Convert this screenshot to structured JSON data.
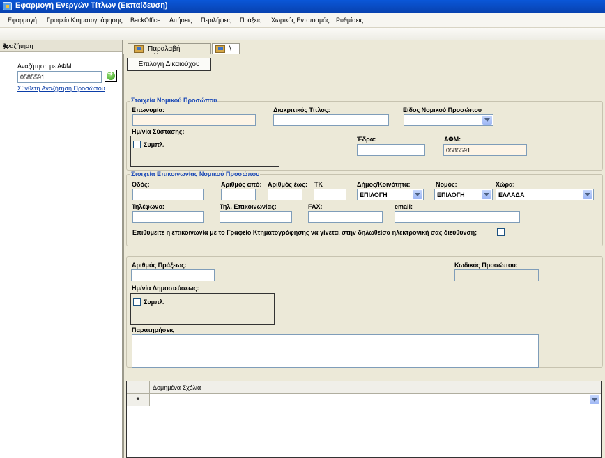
{
  "window": {
    "title": "Εφαρμογή Ενεργών Τίτλων (Εκπαίδευση)"
  },
  "menu": [
    "Εφαρμογή",
    "Γραφείο Κτηματογράφησης",
    "BackOffice",
    "Αιτήσεις",
    "Περιλήψεις",
    "Πράξεις",
    "Χωρικός Εντοπισμός",
    "Ρυθμίσεις"
  ],
  "search_panel": {
    "title": "Αναζήτηση",
    "afm_label": "Αναζήτηση με ΑΦΜ:",
    "afm_value": "0585591",
    "advanced_link": "Σύνθετη Αναζήτηση Προσώπου",
    "pin_glyph": "ᵖ",
    "close_glyph": "✕"
  },
  "tabs": [
    {
      "label": "Παραλαβή Δήλωσης"
    },
    {
      "label": "\\"
    }
  ],
  "select_beneficiary_button": "Επιλογή Δικαιούχου",
  "legal_entity": {
    "title": "Στοιχεία Νομικού Προσώπου",
    "name_label": "Επωνυμία:",
    "name_value": "",
    "distinctive_title_label": "Διακριτικός Τίτλος:",
    "distinctive_title_value": "",
    "entity_type_label": "Είδος Νομικού Προσώπου",
    "entity_type_value": "",
    "founding_date_label": "Ημ/νία Σύστασης:",
    "founding_complete_label": "Συμπλ.",
    "seat_label": "Έδρα:",
    "seat_value": "",
    "afm_label": "ΑΦΜ:",
    "afm_value": "0585591"
  },
  "contact": {
    "title": "Στοιχεία Επικοινωνίας Νομικού Προσώπου",
    "street_label": "Οδός:",
    "number_from_label": "Αριθμός από:",
    "number_to_label": "Αριθμός έως:",
    "postal_label": "ΤΚ",
    "municipality_label": "Δήμος/Κοινότητα:",
    "municipality_value": "ΕΠΙΛΟΓΗ",
    "prefecture_label": "Νομός:",
    "prefecture_value": "ΕΠΙΛΟΓΗ",
    "country_label": "Χώρα:",
    "country_value": "ΕΛΛΑΔΑ",
    "phone_label": "Τηλέφωνο:",
    "contact_phone_label": "Τηλ. Επικοινωνίας:",
    "fax_label": "FAX:",
    "email_label": "email:",
    "electronic_contact_question": "Επιθυμείτε η επικοινωνία με το Γραφείο Κτηματογράφησης να γίνεται στην δηλωθείσα ηλεκτρονική σας διεύθυνση;"
  },
  "act": {
    "act_number_label": "Αριθμός Πράξεως:",
    "person_code_label": "Κωδικός Προσώπου:",
    "publication_date_label": "Ημ/νία Δημοσιεύσεως:",
    "publication_complete_label": "Συμπλ.",
    "notes_label": "Παρατηρήσεις"
  },
  "grid": {
    "column": "Δομημένα Σχόλια",
    "new_row_marker": "*"
  }
}
